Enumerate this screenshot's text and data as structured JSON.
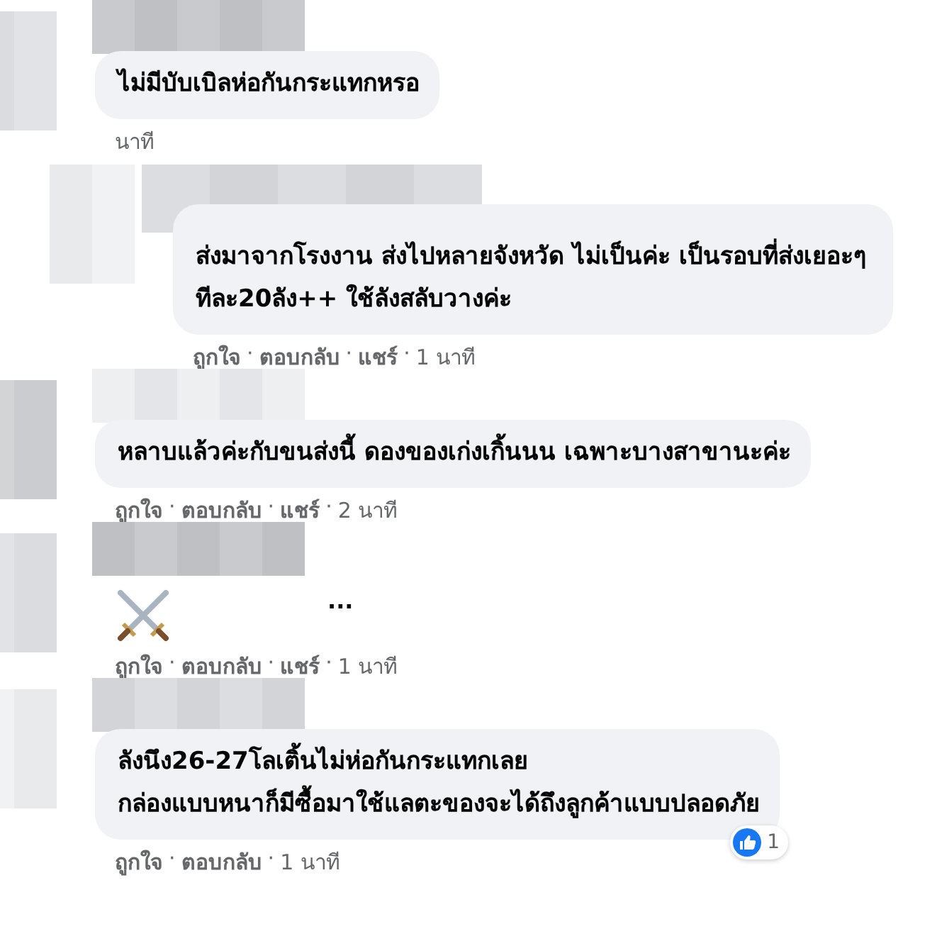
{
  "separator": "·",
  "comments": [
    {
      "kind": "text",
      "reply": false,
      "text": "ไม่มีบับเบิลห่อกันกระแทกหรอ",
      "time": "นาที"
    },
    {
      "kind": "text",
      "reply": true,
      "text": "ส่งมาจากโรงงาน ส่งไปหลายจังหวัด ไม่เป็นค่ะ เป็นรอบที่ส่งเยอะๆทีละ20ลัง++ ใช้ลังสลับวางค่ะ",
      "actions": [
        "ถูกใจ",
        "ตอบกลับ",
        "แชร์"
      ],
      "time": "1 นาที"
    },
    {
      "kind": "text",
      "reply": false,
      "text": "หลาบแล้วค่ะกับขนส่งนี้ ดองของเก่งเกิ้นนน เฉพาะบางสาขานะค่ะ",
      "actions": [
        "ถูกใจ",
        "ตอบกลับ",
        "แชร์"
      ],
      "time": "2 นาที"
    },
    {
      "kind": "sticker",
      "reply": false,
      "more": "...",
      "actions": [
        "ถูกใจ",
        "ตอบกลับ",
        "แชร์"
      ],
      "time": "1 นาที"
    },
    {
      "kind": "text",
      "reply": false,
      "text": "ลังนึง26-27โลเติ้นไม่ห่อกันกระแทกเลย\nกล่องแบบหนาก็มีซื้อมาใช้แลตะของจะได้ถึงลูกค้าแบบปลอดภัย",
      "reactions": "1",
      "actions": [
        "ถูกใจ",
        "ตอบกลับ"
      ],
      "time": "1 นาที"
    }
  ]
}
